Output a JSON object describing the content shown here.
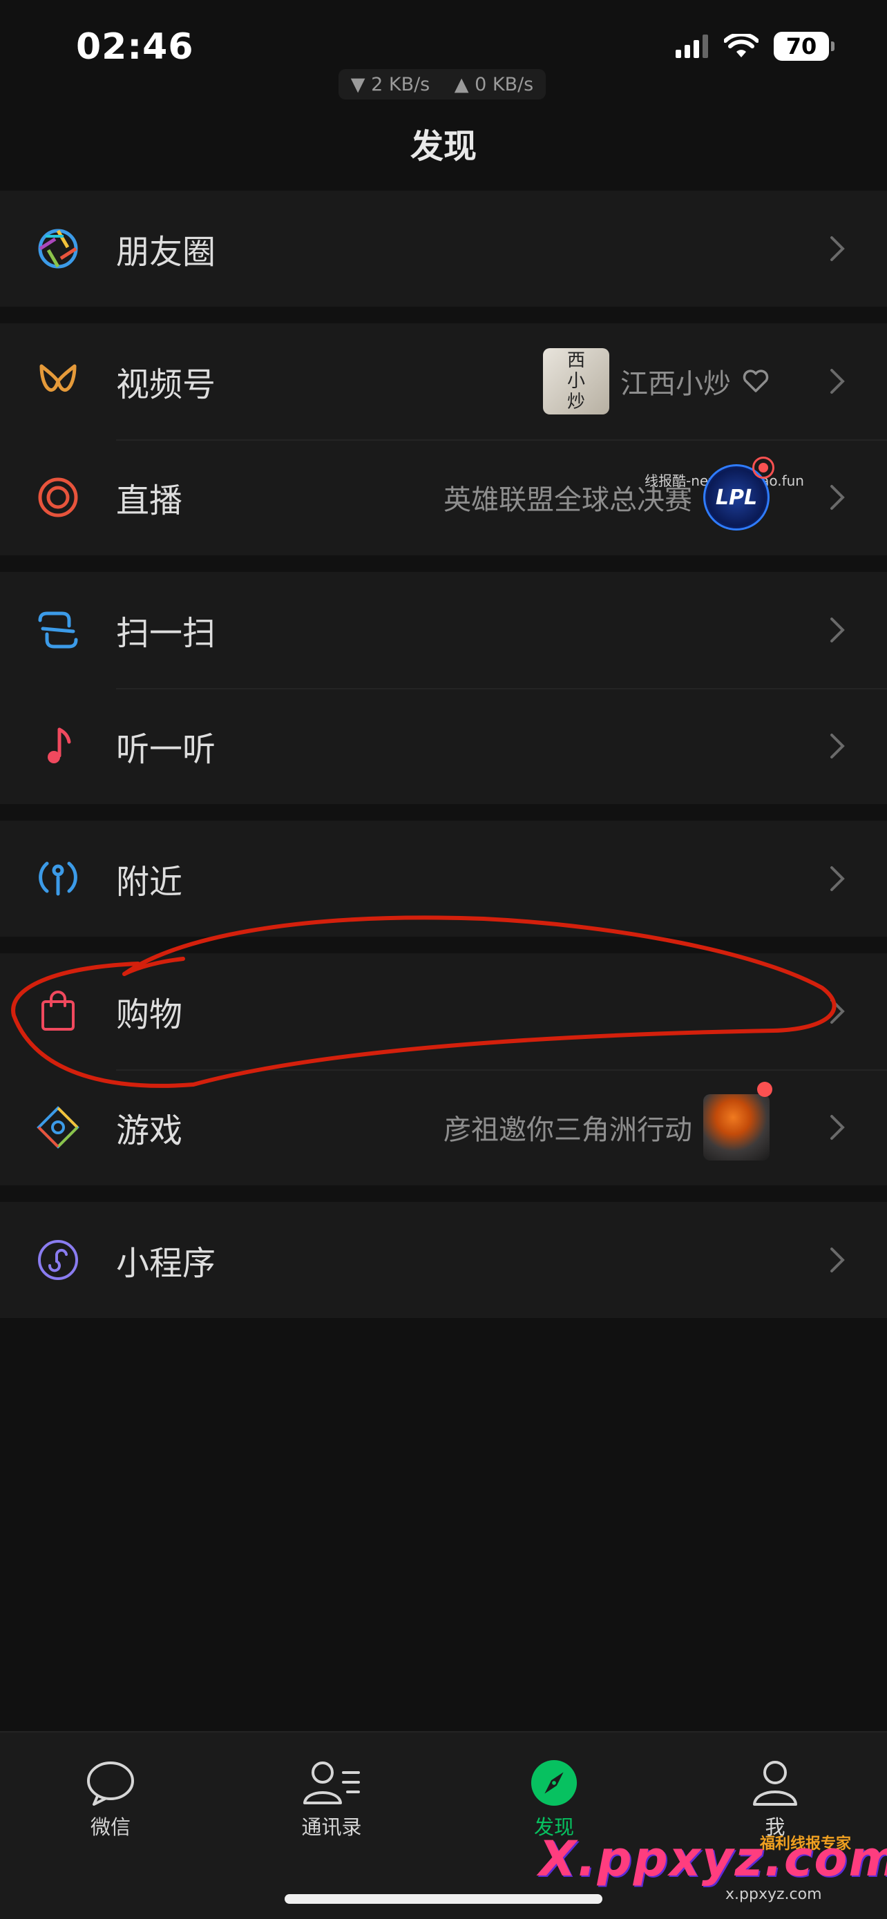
{
  "status_bar": {
    "time": "02:46",
    "download_speed": "▼ 2 KB/s",
    "upload_speed": "▲ 0 KB/s",
    "battery": "70"
  },
  "title": "发现",
  "groups": [
    {
      "rows": [
        {
          "label": "朋友圈"
        }
      ]
    },
    {
      "rows": [
        {
          "label": "视频号",
          "extra_text": "江西小炒",
          "thumb_text": [
            "西",
            "小",
            "炒"
          ]
        },
        {
          "label": "直播",
          "extra_text": "英雄联盟全球总决赛",
          "badge_text": "LPL",
          "watermark": "线报酷-new.xianbao.fun"
        }
      ]
    },
    {
      "rows": [
        {
          "label": "扫一扫"
        },
        {
          "label": "听一听"
        }
      ]
    },
    {
      "rows": [
        {
          "label": "附近"
        }
      ]
    },
    {
      "rows": [
        {
          "label": "购物"
        },
        {
          "label": "游戏",
          "extra_text": "彦祖邀你三角洲行动"
        }
      ]
    },
    {
      "rows": [
        {
          "label": "小程序"
        }
      ]
    }
  ],
  "tabs": [
    {
      "label": "微信",
      "icon": "chat-bubble-icon"
    },
    {
      "label": "通讯录",
      "icon": "contacts-icon"
    },
    {
      "label": "发现",
      "icon": "compass-icon",
      "active": true
    },
    {
      "label": "我",
      "icon": "person-icon"
    }
  ],
  "overlay": {
    "site_logo": "X.ppxyz.com",
    "site_logo_small": "x.ppxyz.com",
    "badge_label": "福利线报专家"
  },
  "colors": {
    "active_tab": "#07c160",
    "annotation": "#d4200c",
    "dot": "#fa5151"
  }
}
